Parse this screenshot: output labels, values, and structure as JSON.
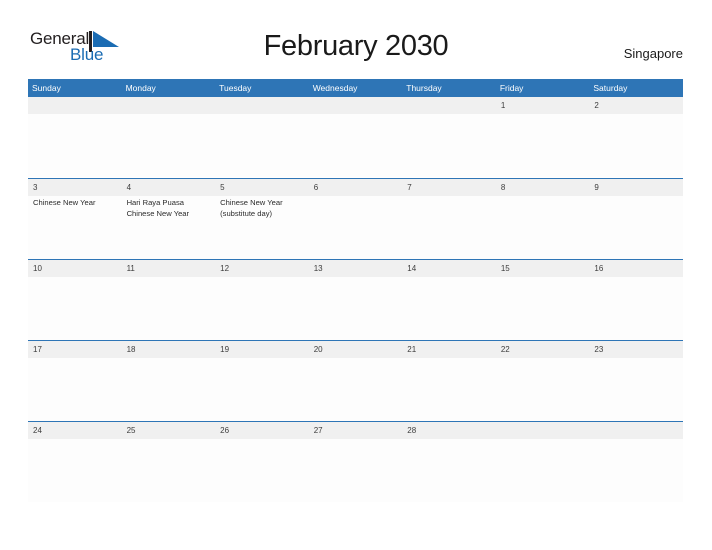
{
  "brand": {
    "word_general": "General",
    "word_blue": "Blue"
  },
  "header": {
    "title": "February 2030",
    "location": "Singapore"
  },
  "colors": {
    "header_blue": "#2e75b6",
    "divider_blue": "#2e75b6",
    "date_band_gray": "#f0f0f0",
    "logo_blue": "#1b6cb3",
    "text_dark": "#2b2b2b"
  },
  "calendar": {
    "weekdays": [
      "Sunday",
      "Monday",
      "Tuesday",
      "Wednesday",
      "Thursday",
      "Friday",
      "Saturday"
    ],
    "weeks": [
      {
        "days": [
          {
            "date": "",
            "events": []
          },
          {
            "date": "",
            "events": []
          },
          {
            "date": "",
            "events": []
          },
          {
            "date": "",
            "events": []
          },
          {
            "date": "",
            "events": []
          },
          {
            "date": "1",
            "events": []
          },
          {
            "date": "2",
            "events": []
          }
        ]
      },
      {
        "days": [
          {
            "date": "3",
            "events": [
              "Chinese New Year"
            ]
          },
          {
            "date": "4",
            "events": [
              "Hari Raya Puasa",
              "Chinese New Year"
            ]
          },
          {
            "date": "5",
            "events": [
              "Chinese New Year (substitute day)"
            ]
          },
          {
            "date": "6",
            "events": []
          },
          {
            "date": "7",
            "events": []
          },
          {
            "date": "8",
            "events": []
          },
          {
            "date": "9",
            "events": []
          }
        ]
      },
      {
        "days": [
          {
            "date": "10",
            "events": []
          },
          {
            "date": "11",
            "events": []
          },
          {
            "date": "12",
            "events": []
          },
          {
            "date": "13",
            "events": []
          },
          {
            "date": "14",
            "events": []
          },
          {
            "date": "15",
            "events": []
          },
          {
            "date": "16",
            "events": []
          }
        ]
      },
      {
        "days": [
          {
            "date": "17",
            "events": []
          },
          {
            "date": "18",
            "events": []
          },
          {
            "date": "19",
            "events": []
          },
          {
            "date": "20",
            "events": []
          },
          {
            "date": "21",
            "events": []
          },
          {
            "date": "22",
            "events": []
          },
          {
            "date": "23",
            "events": []
          }
        ]
      },
      {
        "days": [
          {
            "date": "24",
            "events": []
          },
          {
            "date": "25",
            "events": []
          },
          {
            "date": "26",
            "events": []
          },
          {
            "date": "27",
            "events": []
          },
          {
            "date": "28",
            "events": []
          },
          {
            "date": "",
            "events": []
          },
          {
            "date": "",
            "events": []
          }
        ]
      }
    ]
  }
}
